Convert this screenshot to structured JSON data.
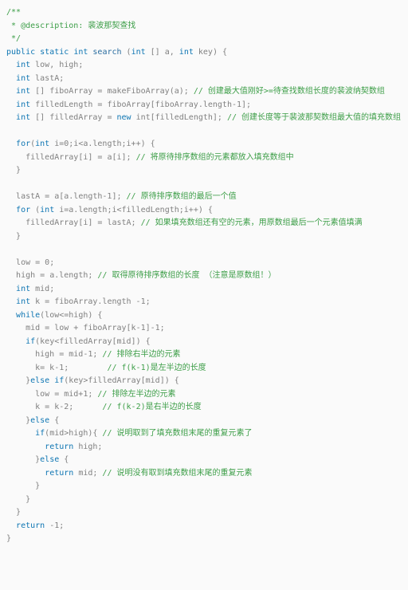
{
  "doc_comment": {
    "open": "/**",
    "line": " * @description: 裴波那契查找",
    "close": " */"
  },
  "sig": {
    "mods": "public static",
    "ret": "int",
    "name": "search",
    "params_open": " (",
    "p1_type": "int",
    "p1_name": " [] a, ",
    "p2_type": "int",
    "p2_name": " key) {"
  },
  "l": {
    "d1a": "int",
    "d1b": " low, high;",
    "d2a": "int",
    "d2b": " lastA;",
    "d3a": "int",
    "d3b": " [] fiboArray = makeFiboArray(a); ",
    "d3c": "// 创建最大值刚好>=待查找数组长度的裴波纳契数组",
    "d4a": "int",
    "d4b": " filledLength = fiboArray[fiboArray.length-1];",
    "d5a": "int",
    "d5b": " [] filledArray = ",
    "d5c": "new",
    "d5d": " int[filledLength]; ",
    "d5e": "// 创建长度等于裴波那契数组最大值的填充数组",
    "f1a": "for",
    "f1b": "(",
    "f1c": "int",
    "f1d": " i=0;i<a.length;i++) {",
    "f1e": "filledArray[i] = a[i]; ",
    "f1f": "// 将原待排序数组的元素都放入填充数组中",
    "rb": "}",
    "la1": "lastA = a[a.length-1]; ",
    "la1c": "// 原待排序数组的最后一个值",
    "f2a": "for",
    "f2b": " (",
    "f2c": "int",
    "f2d": " i=a.length;i<filledLength;i++) {",
    "f2e": "filledArray[i] = lastA; ",
    "f2f": "// 如果填充数组还有空的元素，用原数组最后一个元素值填满",
    "low": "low = 0;",
    "hi1": "high = a.length; ",
    "hi1c": "// 取得原待排序数组的长度 （注意是原数组！）",
    "mid": "int",
    "midb": " mid;",
    "k1a": "int",
    "k1b": " k = fiboArray.length -1;",
    "wh1": "while",
    "wh1b": "(low<=high) {",
    "m1": "mid = low + fiboArray[k-1]-1;",
    "if1a": "if",
    "if1b": "(key<filledArray[mid]) {",
    "hm1": "high = mid-1; ",
    "hm1c": "// 排除右半边的元素",
    "kk1": "k= k-1;        ",
    "kk1c": "// f(k-1)是左半边的长度",
    "el1a": "}",
    "el1b": "else",
    "el1c": " if",
    "el1d": "(key>filledArray[mid]) {",
    "lm1": "low = mid+1; ",
    "lm1c": "// 排除左半边的元素",
    "kk2": "k = k-2;      ",
    "kk2c": "// f(k-2)是右半边的长度",
    "el2a": "}",
    "el2b": "else",
    "el2c": " {",
    "if2a": "if",
    "if2b": "(mid>high){ ",
    "if2c": "// 说明取到了填充数组末尾的重复元素了",
    "ret1a": "return",
    "ret1b": " high;",
    "el3a": "}",
    "el3b": "else",
    "el3c": " {",
    "ret2a": "return",
    "ret2b": " mid; ",
    "ret2c": "// 说明没有取到填充数组末尾的重复元素",
    "retn1a": "return",
    "retn1b": " -1;"
  }
}
